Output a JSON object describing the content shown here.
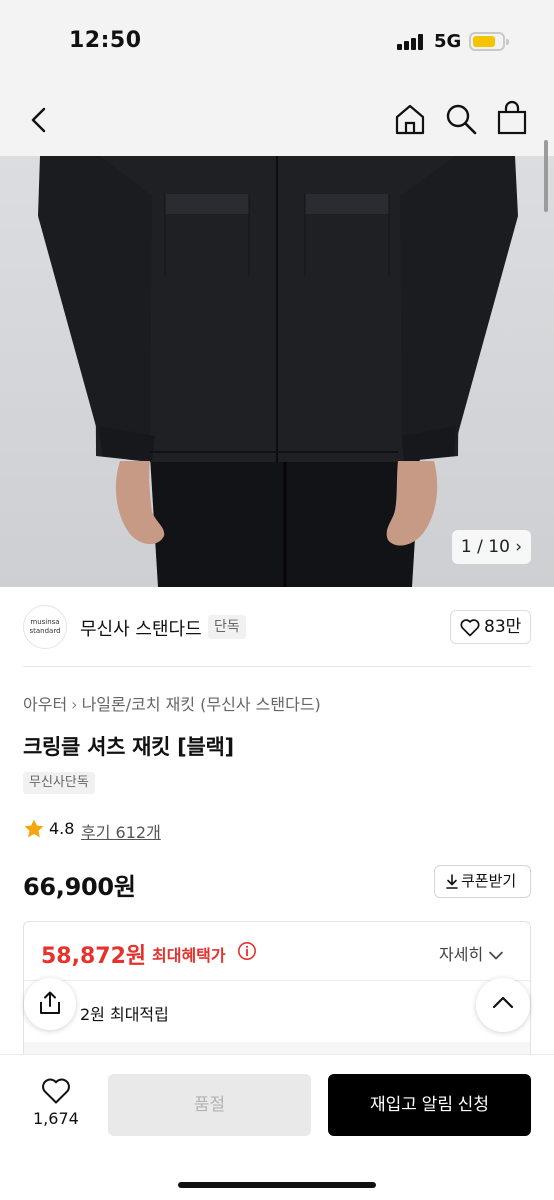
{
  "status_bar": {
    "time": "12:50",
    "network": "5G"
  },
  "colors": {
    "accent_red": "#e5322d",
    "primary_black": "#000000",
    "disabled_grey": "#e9e9e9",
    "battery_yellow": "#f4c400"
  },
  "icons": {
    "back": "chevron-left-icon",
    "home": "home-icon",
    "search": "search-icon",
    "cart": "shopping-bag-icon",
    "like": "heart-icon",
    "star": "star-icon",
    "download": "download-icon",
    "info": "info-icon",
    "share": "share-icon",
    "scroll_top": "chevron-up-icon"
  },
  "gallery": {
    "counter": "1 / 10 ›"
  },
  "brand": {
    "logo_line1": "musinsa",
    "logo_line2": "standard",
    "name": "무신사 스탠다드",
    "badge": "단독",
    "likes": "83만"
  },
  "product": {
    "breadcrumb": [
      "아우터",
      "나일론/코치 재킷 (무신사 스탠다드)"
    ],
    "breadcrumb_sep": "›",
    "title": "크링클 셔츠 재킷 [블랙]",
    "tag": "무신사단독",
    "rating": "4.8",
    "reviews": "후기 612개",
    "price": "66,900원",
    "coupon_label": "쿠폰받기"
  },
  "benefit": {
    "max_price": "58,872원",
    "max_label": "최대혜택가",
    "details_label": "자세히",
    "points": "2원 최대적립"
  },
  "bottom_bar": {
    "wish_count": "1,674",
    "soldout_label": "품절",
    "restock_label": "재입고 알림 신청"
  }
}
